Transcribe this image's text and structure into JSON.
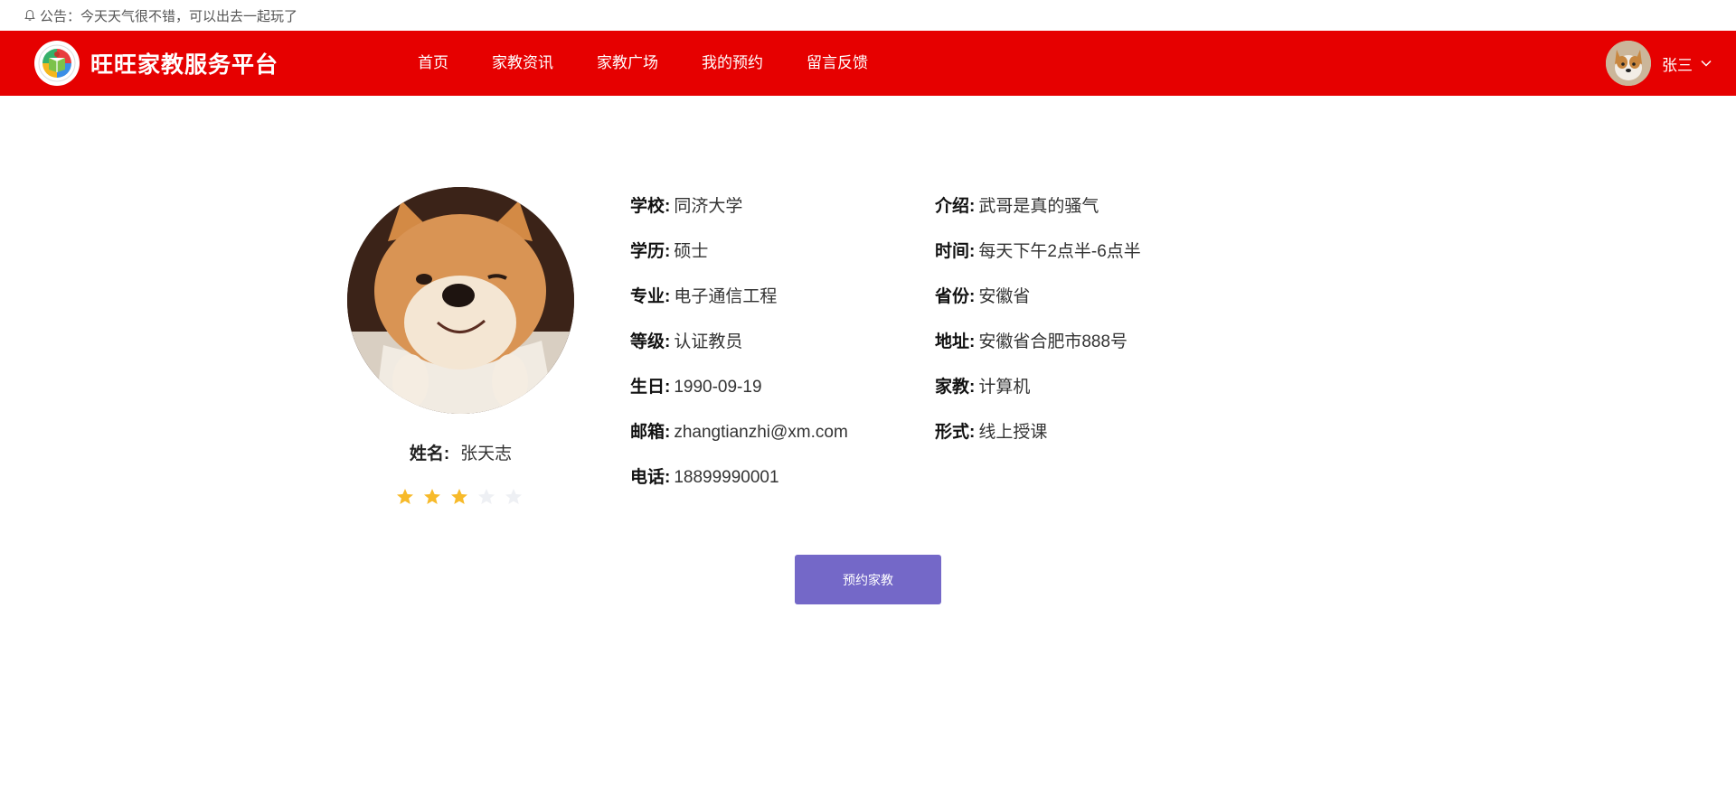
{
  "notice": {
    "text": "公告：今天天气很不错，可以出去一起玩了"
  },
  "header": {
    "brand": "旺旺家教服务平台",
    "menu": [
      "首页",
      "家教资讯",
      "家教广场",
      "我的预约",
      "留言反馈"
    ],
    "user_name": "张三",
    "accent_color": "#e60000"
  },
  "profile": {
    "name_label": "姓名:",
    "name": "张天志",
    "rating": 3,
    "rating_max": 5,
    "left_fields": [
      {
        "label": "学校:",
        "value": "同济大学"
      },
      {
        "label": "学历:",
        "value": "硕士"
      },
      {
        "label": "专业:",
        "value": "电子通信工程"
      },
      {
        "label": "等级:",
        "value": "认证教员"
      },
      {
        "label": "生日:",
        "value": "1990-09-19"
      },
      {
        "label": "邮箱:",
        "value": "zhangtianzhi@xm.com"
      },
      {
        "label": "电话:",
        "value": "18899990001"
      }
    ],
    "right_fields": [
      {
        "label": "介绍:",
        "value": "武哥是真的骚气"
      },
      {
        "label": "时间:",
        "value": "每天下午2点半-6点半"
      },
      {
        "label": "省份:",
        "value": "安徽省"
      },
      {
        "label": "地址:",
        "value": "安徽省合肥市888号"
      },
      {
        "label": "家教:",
        "value": "计算机"
      },
      {
        "label": "形式:",
        "value": "线上授课"
      }
    ]
  },
  "actions": {
    "book_label": "预约家教",
    "button_color": "#7468c8"
  },
  "icons": [
    "bell-icon",
    "logo-icon",
    "chevron-down-icon",
    "star-icon"
  ]
}
